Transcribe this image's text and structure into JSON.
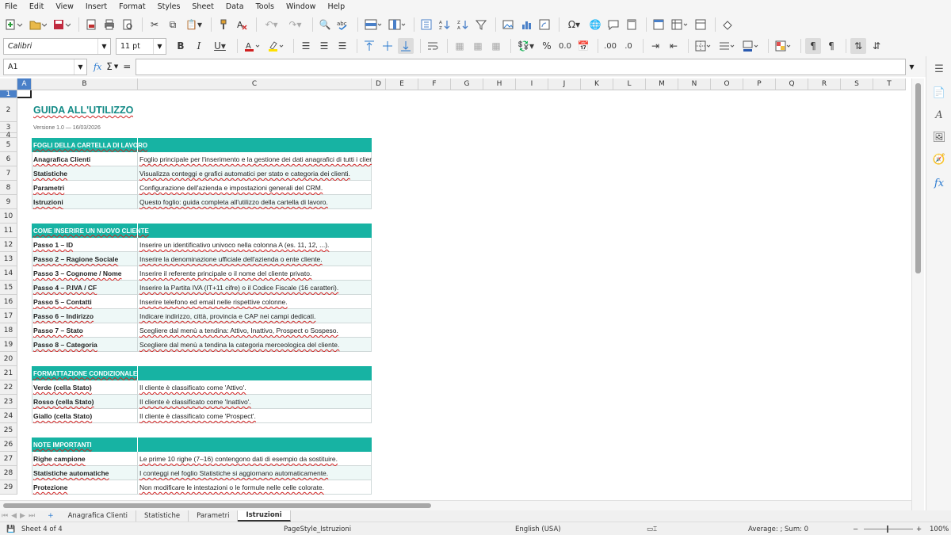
{
  "menu": [
    "File",
    "Edit",
    "View",
    "Insert",
    "Format",
    "Styles",
    "Sheet",
    "Data",
    "Tools",
    "Window",
    "Help"
  ],
  "toolbar": {
    "font_name": "Calibri",
    "font_size": "11 pt"
  },
  "formula_bar": {
    "name_box": "A1",
    "fx_label": "fx",
    "sum_label": "Σ",
    "eq_label": "=",
    "content": ""
  },
  "columns": [
    "A",
    "B",
    "C",
    "D",
    "E",
    "F",
    "G",
    "H",
    "I",
    "J",
    "K",
    "L",
    "M",
    "N",
    "O",
    "P",
    "Q",
    "R",
    "S",
    "T"
  ],
  "rows": [
    "1",
    "2",
    "3",
    "4",
    "5",
    "6",
    "7",
    "8",
    "9",
    "10",
    "11",
    "12",
    "13",
    "14",
    "15",
    "16",
    "17",
    "18",
    "19",
    "20",
    "21",
    "22",
    "23",
    "24",
    "25",
    "26",
    "27",
    "28",
    "29"
  ],
  "sheet": {
    "title": "GUIDA ALL'UTILIZZO",
    "version": "Versione 1.0 — 16/03/2026",
    "sections": [
      {
        "header": "FOGLI DELLA CARTELLA DI LAVORO",
        "items": [
          [
            "Anagrafica Clienti",
            "Foglio principale per l'inserimento e la gestione dei dati anagrafici di tutti i clienti."
          ],
          [
            "Statistiche",
            "Visualizza conteggi e grafici automatici per stato e categoria dei clienti."
          ],
          [
            "Parametri",
            "Configurazione dell'azienda e impostazioni generali del CRM."
          ],
          [
            "Istruzioni",
            "Questo foglio: guida completa all'utilizzo della cartella di lavoro."
          ]
        ]
      },
      {
        "header": "COME INSERIRE UN NUOVO CLIENTE",
        "items": [
          [
            "Passo 1 – ID",
            "Inserire un identificativo univoco nella colonna A (es. 11, 12, ...)."
          ],
          [
            "Passo 2 – Ragione Sociale",
            "Inserire la denominazione ufficiale dell'azienda o ente cliente."
          ],
          [
            "Passo 3 – Cognome / Nome",
            "Inserire il referente principale o il nome del cliente privato."
          ],
          [
            "Passo 4 – P.IVA / CF",
            "Inserire la Partita IVA (IT+11 cifre) o il Codice Fiscale (16 caratteri)."
          ],
          [
            "Passo 5 – Contatti",
            "Inserire telefono ed email nelle rispettive colonne."
          ],
          [
            "Passo 6 – Indirizzo",
            "Indicare indirizzo, città, provincia e CAP nei campi dedicati."
          ],
          [
            "Passo 7 – Stato",
            "Scegliere dal menù a tendina: Attivo, Inattivo, Prospect o Sospeso."
          ],
          [
            "Passo 8 – Categoria",
            "Scegliere dal menù a tendina la categoria merceologica del cliente."
          ]
        ]
      },
      {
        "header": "FORMATTAZIONE CONDIZIONALE",
        "items": [
          [
            "Verde (cella Stato)",
            "Il cliente è classificato come 'Attivo'."
          ],
          [
            "Rosso (cella Stato)",
            "Il cliente è classificato come 'Inattivo'."
          ],
          [
            "Giallo (cella Stato)",
            "Il cliente è classificato come 'Prospect'."
          ]
        ]
      },
      {
        "header": "NOTE IMPORTANTI",
        "items": [
          [
            "Righe campione",
            "Le prime 10 righe (7–16) contengono dati di esempio da sostituire."
          ],
          [
            "Statistiche automatiche",
            "I conteggi nel foglio Statistiche si aggiornano automaticamente."
          ],
          [
            "Protezione",
            "Non modificare le intestazioni o le formule nelle celle colorate."
          ]
        ]
      }
    ]
  },
  "tabs": [
    "Anagrafica Clienti",
    "Statistiche",
    "Parametri",
    "Istruzioni"
  ],
  "active_tab": "Istruzioni",
  "status": {
    "sheet_info": "Sheet 4 of 4",
    "page_style": "PageStyle_Istruzioni",
    "language": "English (USA)",
    "summary": "Average: ; Sum: 0",
    "zoom": "100%"
  },
  "colors": {
    "section_header": "#17b3a3",
    "row_alt": "#eef8f7",
    "title_text": "#138a86",
    "selection": "#4a80c8"
  }
}
